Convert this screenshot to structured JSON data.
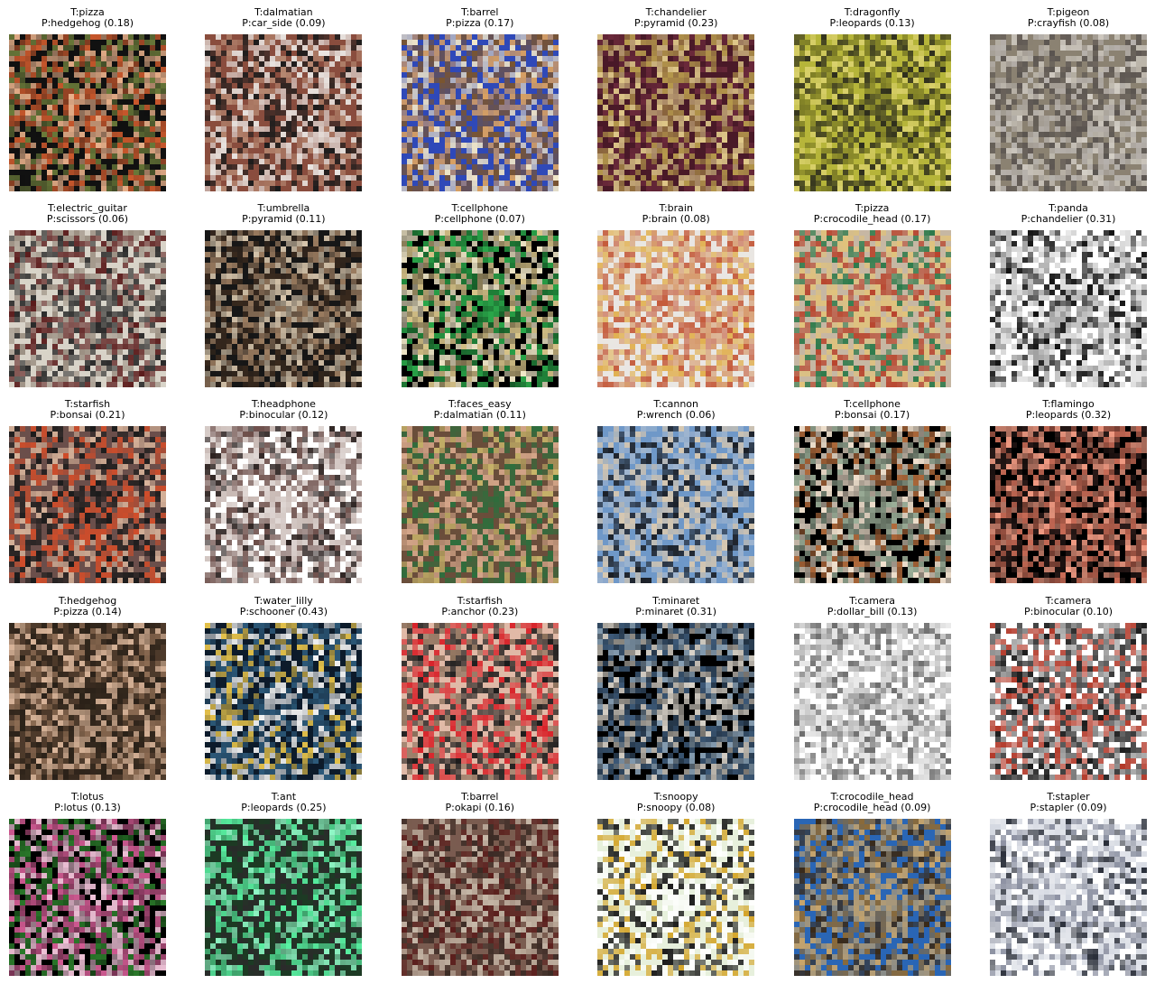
{
  "figure": {
    "cells": [
      {
        "true_label": "T:pizza",
        "pred_label": "P:hedgehog (0.18)",
        "palette": [
          "#111111",
          "#c9582c",
          "#e8b08a",
          "#6b7b3a"
        ]
      },
      {
        "true_label": "T:dalmatian",
        "pred_label": "P:car_side (0.09)",
        "palette": [
          "#8a4d3e",
          "#e9e4e0",
          "#1c1c1c",
          "#b58770"
        ]
      },
      {
        "true_label": "T:barrel",
        "pred_label": "P:pizza (0.17)",
        "palette": [
          "#2f49b8",
          "#d8a062",
          "#7a5530",
          "#f0e6c8"
        ]
      },
      {
        "true_label": "T:chandelier",
        "pred_label": "P:pyramid (0.23)",
        "palette": [
          "#4a1a28",
          "#b79a4d",
          "#e0c98a",
          "#6b2a3b"
        ]
      },
      {
        "true_label": "T:dragonfly",
        "pred_label": "P:leopards (0.13)",
        "palette": [
          "#b6b53a",
          "#7a7a25",
          "#2f2f1d",
          "#dad16d"
        ]
      },
      {
        "true_label": "T:pigeon",
        "pred_label": "P:crayfish (0.08)",
        "palette": [
          "#8b8272",
          "#b7b2ad",
          "#5a5450",
          "#d3cec6"
        ]
      },
      {
        "true_label": "T:electric_guitar",
        "pred_label": "P:scissors (0.06)",
        "palette": [
          "#d8d3c8",
          "#5a1a1a",
          "#2a2a2a",
          "#9b8f82"
        ]
      },
      {
        "true_label": "T:umbrella",
        "pred_label": "P:pyramid (0.11)",
        "palette": [
          "#171717",
          "#9b7c60",
          "#d9c7ad",
          "#3a2a1e"
        ]
      },
      {
        "true_label": "T:cellphone",
        "pred_label": "P:cellphone (0.07)",
        "palette": [
          "#000000",
          "#d9c58a",
          "#2aa84a",
          "#f1e8c8"
        ]
      },
      {
        "true_label": "T:brain",
        "pred_label": "P:brain (0.08)",
        "palette": [
          "#e9e6e2",
          "#d69a6c",
          "#c45a3a",
          "#e1b050"
        ]
      },
      {
        "true_label": "T:pizza",
        "pred_label": "P:crocodile_head (0.17)",
        "palette": [
          "#c6b7a3",
          "#b8442d",
          "#e1c27a",
          "#2d7a4b"
        ]
      },
      {
        "true_label": "T:panda",
        "pred_label": "P:chandelier (0.31)",
        "palette": [
          "#ffffff",
          "#111111",
          "#9d9d9d",
          "#d6d6d6"
        ]
      },
      {
        "true_label": "T:starfish",
        "pred_label": "P:bonsai (0.21)",
        "palette": [
          "#6b4f4b",
          "#d04d2a",
          "#1b1b1b",
          "#d7b39a"
        ]
      },
      {
        "true_label": "T:headphone",
        "pred_label": "P:binocular (0.12)",
        "palette": [
          "#ffffff",
          "#6d4f4a",
          "#c8b9b4",
          "#2a1f1d"
        ]
      },
      {
        "true_label": "T:faces_easy",
        "pred_label": "P:dalmatian (0.11)",
        "palette": [
          "#6a4e3b",
          "#d7a88b",
          "#2d6f3d",
          "#c9b56a"
        ]
      },
      {
        "true_label": "T:cannon",
        "pred_label": "P:wrench (0.06)",
        "palette": [
          "#6f98c8",
          "#1b1f26",
          "#d8c8b0",
          "#a1b6cf"
        ]
      },
      {
        "true_label": "T:cellphone",
        "pred_label": "P:bonsai (0.17)",
        "palette": [
          "#000000",
          "#f2e2cf",
          "#9db09a",
          "#b06a3b"
        ]
      },
      {
        "true_label": "T:flamingo",
        "pred_label": "P:leopards (0.32)",
        "palette": [
          "#000000",
          "#f29b83",
          "#c96b56",
          "#2a1a18"
        ]
      },
      {
        "true_label": "T:hedgehog",
        "pred_label": "P:pizza (0.14)",
        "palette": [
          "#4d3a2b",
          "#d9b59a",
          "#2a2118",
          "#8e6d54"
        ]
      },
      {
        "true_label": "T:water_lilly",
        "pred_label": "P:schooner (0.43)",
        "palette": [
          "#0d1b2b",
          "#2d5a7a",
          "#f2f2f2",
          "#e4c14a"
        ]
      },
      {
        "true_label": "T:starfish",
        "pred_label": "P:anchor (0.23)",
        "palette": [
          "#e0b9a7",
          "#d8232a",
          "#1b1b1b",
          "#8a6f5a"
        ]
      },
      {
        "true_label": "T:minaret",
        "pred_label": "P:minaret (0.31)",
        "palette": [
          "#000000",
          "#3e5b7a",
          "#d8d2c8",
          "#88a0b5"
        ]
      },
      {
        "true_label": "T:camera",
        "pred_label": "P:dollar_bill (0.13)",
        "palette": [
          "#ffffff",
          "#b8b8b8",
          "#6c6c6c",
          "#d9d9d9"
        ]
      },
      {
        "true_label": "T:camera",
        "pred_label": "P:binocular (0.10)",
        "palette": [
          "#ffffff",
          "#1b1b1b",
          "#b33a2a",
          "#8a8a8a"
        ]
      },
      {
        "true_label": "T:lotus",
        "pred_label": "P:lotus (0.13)",
        "palette": [
          "#000000",
          "#d05a92",
          "#f0c2d8",
          "#2a7a2a"
        ]
      },
      {
        "true_label": "T:ant",
        "pred_label": "P:leopards (0.25)",
        "palette": [
          "#1d3a24",
          "#59f2a3",
          "#2b2b2b",
          "#8ef7c5"
        ]
      },
      {
        "true_label": "T:barrel",
        "pred_label": "P:okapi (0.16)",
        "palette": [
          "#7a5c50",
          "#5a1d1b",
          "#c6b8a8",
          "#3a2a24"
        ]
      },
      {
        "true_label": "T:snoopy",
        "pred_label": "P:snoopy (0.08)",
        "palette": [
          "#e7f0dc",
          "#1b1b1b",
          "#ffffff",
          "#d4a52a"
        ]
      },
      {
        "true_label": "T:crocodile_head",
        "pred_label": "P:crocodile_head (0.09)",
        "palette": [
          "#2a66b5",
          "#8a6a3a",
          "#c9a56a",
          "#3a2a18"
        ]
      },
      {
        "true_label": "T:stapler",
        "pred_label": "P:stapler (0.09)",
        "palette": [
          "#ffffff",
          "#d3d7e0",
          "#8a8fa0",
          "#2a2f3a"
        ]
      }
    ]
  }
}
